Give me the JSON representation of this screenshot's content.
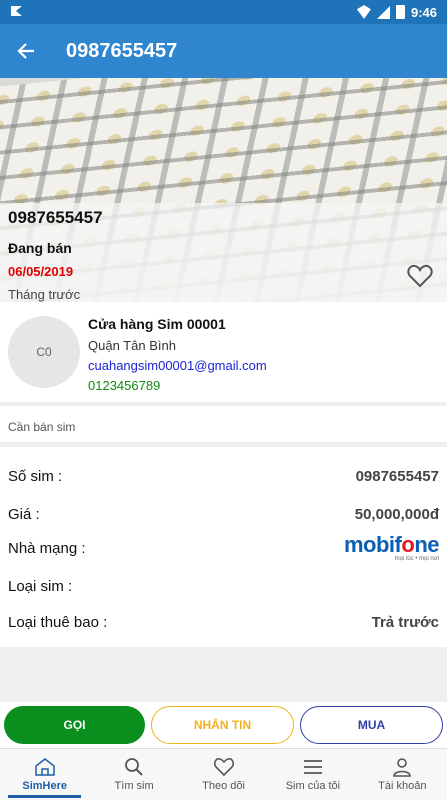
{
  "status_bar": {
    "time": "9:46"
  },
  "app_bar": {
    "title": "0987655457"
  },
  "hero": {
    "number": "0987655457",
    "status": "Đang bán",
    "date": "06/05/2019",
    "ago": "Tháng trước"
  },
  "shop": {
    "avatar_initials": "C0",
    "name": "Cửa hàng Sim 00001",
    "district": "Quận Tân Bình",
    "email": "cuahangsim00001@gmail.com",
    "phone": "0123456789"
  },
  "note": "Cần bán sim",
  "details": {
    "sim_label": "Số sim :",
    "sim_value": "0987655457",
    "price_label": "Giá :",
    "price_value": "50,000,000đ",
    "network_label": "Nhà mạng :",
    "network_logo": {
      "word_prefix": "mobif",
      "word_o": "o",
      "word_suffix": "ne",
      "tagline": "mọi lúc • mọi nơi"
    },
    "type_label": "Loại sim :",
    "type_value": "",
    "subscription_label": "Loại thuê bao :",
    "subscription_value": "Trả trước"
  },
  "actions": {
    "call": "GỌI",
    "message": "NHẮN TIN",
    "buy": "MUA"
  },
  "bottom_nav": [
    {
      "label": "SimHere",
      "icon": "home-icon"
    },
    {
      "label": "Tìm sim",
      "icon": "search-icon"
    },
    {
      "label": "Theo dõi",
      "icon": "heart-icon"
    },
    {
      "label": "Sim của tôi",
      "icon": "menu-icon"
    },
    {
      "label": "Tài khoản",
      "icon": "user-icon"
    }
  ],
  "colors": {
    "app_bar": "#2f86cf",
    "status_bar": "#1f73b8",
    "call": "#0a8f1e",
    "message": "#f2b21f",
    "buy": "#2f3fa8",
    "date": "#e00000"
  }
}
